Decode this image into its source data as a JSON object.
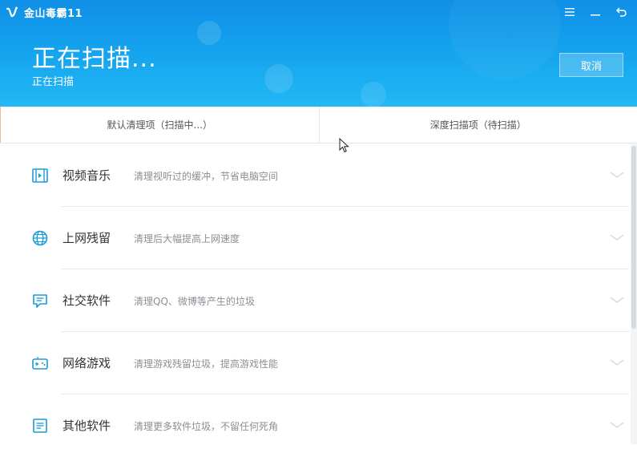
{
  "window": {
    "app_name": "金山毒霸11",
    "controls": [
      "menu-icon",
      "minimize-icon",
      "back-icon"
    ]
  },
  "header": {
    "title": "正在扫描...",
    "subtitle": "正在扫描",
    "cancel_label": "取消"
  },
  "tabs": [
    {
      "label": "默认清理项（扫描中...）",
      "active": true
    },
    {
      "label": "深度扫描项（待扫描）",
      "active": false
    }
  ],
  "items": [
    {
      "icon": "video-music-icon",
      "label": "视频音乐",
      "desc": "清理视听过的缓冲，节省电脑空间"
    },
    {
      "icon": "globe-icon",
      "label": "上网残留",
      "desc": "清理后大幅提高上网速度"
    },
    {
      "icon": "chat-icon",
      "label": "社交软件",
      "desc": "清理QQ、微博等产生的垃圾"
    },
    {
      "icon": "gamepad-icon",
      "label": "网络游戏",
      "desc": "清理游戏残留垃圾，提高游戏性能"
    },
    {
      "icon": "document-icon",
      "label": "其他软件",
      "desc": "清理更多软件垃圾，不留任何死角"
    }
  ],
  "colors": {
    "header_blue": "#16a6ef",
    "icon_blue": "#1a9bd7",
    "active_tab_accent": "#f4b98a"
  }
}
